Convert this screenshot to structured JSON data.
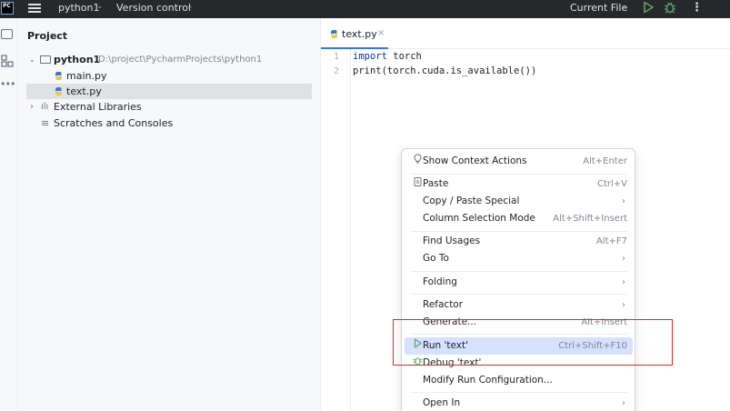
{
  "titlebar": {
    "logo": "PC",
    "project_name": "python1",
    "version_control": "Version control",
    "run_config": "Current File",
    "chevron": "⌄",
    "more": "⋮"
  },
  "project_panel": {
    "title": "Project",
    "tree": [
      {
        "label": "python1",
        "path": "D:\\project\\PycharmProjects\\python1",
        "type": "folder",
        "expanded": true
      },
      {
        "label": "main.py",
        "type": "py"
      },
      {
        "label": "text.py",
        "type": "py",
        "selected": true
      },
      {
        "label": "External Libraries",
        "type": "library",
        "expanded": false
      },
      {
        "label": "Scratches and Consoles",
        "type": "scratches"
      }
    ]
  },
  "editor": {
    "tab_label": "text.py",
    "tab_close": "×",
    "lines": [
      {
        "number": "1",
        "keyword": "import",
        "rest": " torch"
      },
      {
        "number": "2",
        "keyword": "",
        "rest": "print(torch.cuda.is_available())"
      }
    ]
  },
  "context_menu": {
    "items": [
      {
        "label": "Show Context Actions",
        "shortcut": "Alt+Enter",
        "icon": "lightbulb-icon"
      },
      {
        "label": "Paste",
        "shortcut": "Ctrl+V",
        "icon": "clipboard-icon"
      },
      {
        "label": "Copy / Paste Special",
        "submenu": true
      },
      {
        "label": "Column Selection Mode",
        "shortcut": "Alt+Shift+Insert"
      },
      {
        "label": "Find Usages",
        "shortcut": "Alt+F7"
      },
      {
        "label": "Go To",
        "submenu": true
      },
      {
        "label": "Folding",
        "submenu": true
      },
      {
        "label": "Refactor",
        "submenu": true
      },
      {
        "label": "Generate...",
        "shortcut": "Alt+Insert"
      },
      {
        "label": "Run 'text'",
        "shortcut": "Ctrl+Shift+F10",
        "icon": "run-icon",
        "highlighted": true
      },
      {
        "label": "Debug 'text'",
        "icon": "debug-icon"
      },
      {
        "label": "Modify Run Configuration..."
      },
      {
        "label": "Open In",
        "submenu": true
      }
    ],
    "submenu_arrow": "›"
  },
  "colors": {
    "accent": "#3574f0",
    "highlight": "#d5e1ff",
    "annotation": "#e0242a",
    "run_green": "#59a869"
  }
}
